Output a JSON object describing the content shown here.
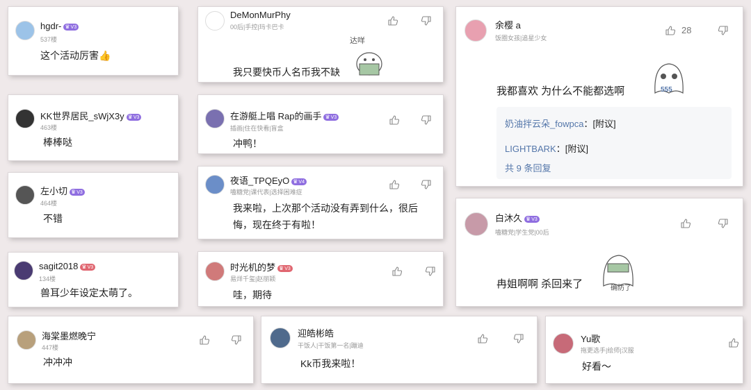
{
  "theme": {
    "accent": "#8f6ee0",
    "badge_red": "#e06670",
    "link": "#5577aa"
  },
  "icons": {
    "like": "thumbs-up-icon",
    "dislike": "thumbs-down-icon"
  },
  "comments": [
    {
      "user": "hgdr-",
      "badge": "V3",
      "meta": "537楼",
      "text": "这个活动厉害",
      "emoji": "👍"
    },
    {
      "user": "DeMonMurPhy",
      "meta": "00后|手控|玛卡巴卡",
      "text": "我只要快币人名币我不缺",
      "sticker_text": "达咩"
    },
    {
      "user": "KK世界居民_sWjX3y",
      "badge": "V3",
      "meta": "463楼",
      "text": "棒棒哒"
    },
    {
      "user": "左小切",
      "badge": "V3",
      "meta": "464楼",
      "text": "不错"
    },
    {
      "user": "sagit2018",
      "badge": "V3",
      "meta": "134楼",
      "text": "兽耳少年设定太萌了。"
    },
    {
      "user": "在游艇上唱 Rap的画手",
      "badge": "V3",
      "meta": "插画|住在快看|盲盒",
      "text": "冲鸭！"
    },
    {
      "user": "夜语_TPQEyO",
      "badge": "V4",
      "meta": "嗑糖党|课代表|选择困难症",
      "text": "我来啦，上次那个活动没有弄到什么，很后悔，现在终于有啦！"
    },
    {
      "user": "时光机的梦",
      "badge": "V3",
      "meta": "易烊千玺|赵丽颖",
      "text": "哇，期待"
    },
    {
      "user": "余樱 a",
      "meta": "饭圈女孩|追星少女",
      "likes": "28",
      "text": "我都喜欢  为什么不能都选啊",
      "sticker_text": "555",
      "replies": [
        {
          "user": "奶油拌云朵_fowpca",
          "sep": "：",
          "text": "[附议]"
        },
        {
          "user": "LIGHTBARK",
          "sep": "：",
          "text": "[附议]"
        }
      ],
      "more": "共 9 条回复"
    },
    {
      "user": "白沐久",
      "badge": "V3",
      "meta": "嗑糖党|学生党|00后",
      "text": "冉姐啊啊 杀回来了",
      "sticker_text": "确防了"
    },
    {
      "user": "海棠墨燃晚宁",
      "meta": "447楼",
      "text": "冲冲冲"
    },
    {
      "user": "迎皓彬皓",
      "meta": "干饭人|干饭第一名|蹦迪",
      "text": "Kk币我来啦！"
    },
    {
      "user": "Yu歌",
      "meta": "拖更选手|绘师|汉服",
      "text": "好看～"
    }
  ]
}
